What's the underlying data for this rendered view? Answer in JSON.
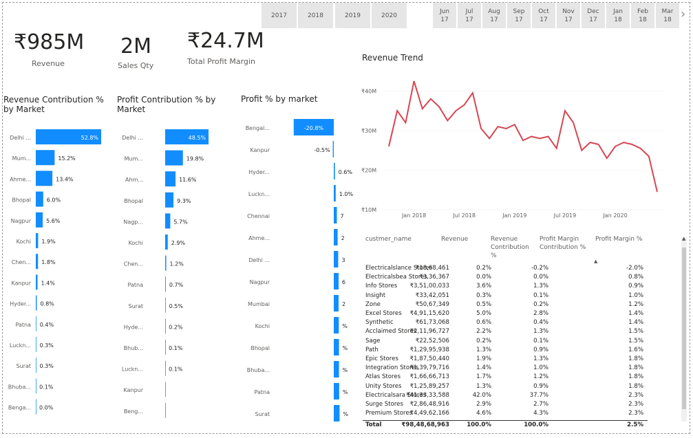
{
  "slicer_years": [
    "2017",
    "2018",
    "2019",
    "2020"
  ],
  "slicer_months": [
    [
      "Jun",
      "17"
    ],
    [
      "Jul",
      "17"
    ],
    [
      "Aug",
      "17"
    ],
    [
      "Sep",
      "17"
    ],
    [
      "Oct",
      "17"
    ],
    [
      "Nov",
      "17"
    ],
    [
      "Dec",
      "17"
    ],
    [
      "Jan",
      "18"
    ],
    [
      "Feb",
      "18"
    ],
    [
      "Mar",
      "18"
    ]
  ],
  "kpis": [
    {
      "value": "₹985M",
      "label": "Revenue"
    },
    {
      "value": "2M",
      "label": "Sales Qty"
    },
    {
      "value": "₹24.7M",
      "label": "Total Profit Margin"
    }
  ],
  "colors": {
    "bar": "#118DFF",
    "line": "#D64550",
    "grid": "#e1e1e1",
    "text": "#252423"
  },
  "chart_data": [
    {
      "type": "bar",
      "title": "Revenue Contribution % by Market",
      "categories": [
        "Delhi ...",
        "Mum...",
        "Ahme...",
        "Bhopal",
        "Nagpur",
        "Kochi",
        "Chen...",
        "Kanpur",
        "Hyder...",
        "Patna",
        "Luckn...",
        "Surat",
        "Bhuba...",
        "Benga..."
      ],
      "values": [
        52.8,
        15.2,
        13.4,
        6.0,
        5.6,
        1.9,
        1.8,
        1.4,
        0.8,
        0.4,
        0.3,
        0.3,
        0.1,
        0.0
      ],
      "labels": [
        "52.8%",
        "15.2%",
        "13.4%",
        "6.0%",
        "5.6%",
        "1.9%",
        "1.8%",
        "1.4%",
        "0.8%",
        "0.4%",
        "0.3%",
        "0.3%",
        "0.1%",
        "0.0%"
      ]
    },
    {
      "type": "bar",
      "title": "Profit Contribution % by Market",
      "categories": [
        "Delhi ...",
        "Mum...",
        "Ahm...",
        "Bhopal",
        "Nagp...",
        "Kochi",
        "Chen...",
        "Patna",
        "Surat",
        "Hyde...",
        "Bhub...",
        "Luckn...",
        "Kanpur",
        "Beng..."
      ],
      "values": [
        48.5,
        19.8,
        11.6,
        9.3,
        5.7,
        2.9,
        1.2,
        0.7,
        0.5,
        0.2,
        0.1,
        0.1,
        0,
        0
      ],
      "labels": [
        "48.5%",
        "19.8%",
        "11.6%",
        "9.3%",
        "5.7%",
        "2.9%",
        "1.2%",
        "0.7%",
        "0.5%",
        "0.2%",
        "0.1%",
        "0.1%",
        "",
        ""
      ]
    },
    {
      "type": "bar",
      "title": "Profit % by market",
      "categories": [
        "Bengal...",
        "Kanpur",
        "Hyder...",
        "Luckn...",
        "Chennai",
        "Ahme...",
        "Delhi ...",
        "Nagpur",
        "Mumbai",
        "Kochi",
        "Bhopal",
        "Bhuba...",
        "Patna",
        "Surat"
      ],
      "values": [
        -20.8,
        -0.5,
        0.6,
        1.0,
        1.6,
        2.0,
        2.3,
        2.5,
        2.5,
        2.6,
        2.7,
        2.7,
        2.8,
        3.0
      ],
      "labels": [
        "-20.8%",
        "-0.5%",
        "0.6%",
        "1.0%",
        "7",
        "2",
        "3",
        "6",
        "2",
        "%",
        "%",
        "%",
        "%",
        "%"
      ]
    },
    {
      "type": "line",
      "title": "Revenue Trend",
      "x_ticks": [
        "Jan 2018",
        "Jul 2018",
        "Jan 2019",
        "Jul 2019",
        "Jan 2020"
      ],
      "y_ticks": [
        "₹10M",
        "₹20M",
        "₹30M",
        "₹40M"
      ],
      "ylim": [
        10,
        43
      ],
      "series": [
        {
          "values": [
            26,
            35,
            32,
            42.5,
            35.5,
            38,
            36,
            32.5,
            35,
            36.5,
            39.5,
            30.5,
            28,
            31,
            30.5,
            31.5,
            27.5,
            28.5,
            28,
            28.5,
            25.5,
            35,
            32,
            25,
            27,
            26.5,
            23,
            26,
            27,
            26.5,
            25.5,
            23.5,
            14.5
          ]
        }
      ]
    }
  ],
  "table": {
    "headers": [
      "custmer_name",
      "Revenue",
      "Revenue Contribution %",
      "Profit Margin Contribution %",
      "Profit Margin %"
    ],
    "rows": [
      [
        "Electricalslance Stores",
        "₹18,68,461",
        "0.2%",
        "-0.2%",
        "-2.0%"
      ],
      [
        "Electricalsbea Stores",
        "₹3,36,367",
        "0.0%",
        "0.0%",
        "0.8%"
      ],
      [
        "Info Stores",
        "₹3,51,00,033",
        "3.6%",
        "1.3%",
        "0.9%"
      ],
      [
        "Insight",
        "₹33,42,051",
        "0.3%",
        "0.1%",
        "1.0%"
      ],
      [
        "Zone",
        "₹50,67,349",
        "0.5%",
        "0.2%",
        "1.2%"
      ],
      [
        "Excel Stores",
        "₹4,91,15,620",
        "5.0%",
        "2.8%",
        "1.4%"
      ],
      [
        "Synthetic",
        "₹61,73,068",
        "0.6%",
        "0.4%",
        "1.4%"
      ],
      [
        "Acclaimed Stores",
        "₹2,11,96,727",
        "2.2%",
        "1.3%",
        "1.5%"
      ],
      [
        "Sage",
        "₹22,52,506",
        "0.2%",
        "0.1%",
        "1.5%"
      ],
      [
        "Path",
        "₹1,29,95,938",
        "1.3%",
        "0.9%",
        "1.6%"
      ],
      [
        "Epic Stores",
        "₹1,87,50,440",
        "1.9%",
        "1.3%",
        "1.8%"
      ],
      [
        "Integration Stores",
        "₹1,39,79,716",
        "1.4%",
        "1.0%",
        "1.8%"
      ],
      [
        "Atlas Stores",
        "₹1,66,66,713",
        "1.7%",
        "1.2%",
        "1.8%"
      ],
      [
        "Unity Stores",
        "₹1,25,89,257",
        "1.3%",
        "0.9%",
        "1.8%"
      ],
      [
        "Electricalsara Stores",
        "₹41,33,33,588",
        "42.0%",
        "37.7%",
        "2.3%"
      ],
      [
        "Surge Stores",
        "₹2,86,48,916",
        "2.9%",
        "2.7%",
        "2.3%"
      ],
      [
        "Premium Stores",
        "₹4,49,62,166",
        "4.6%",
        "4.3%",
        "2.3%"
      ]
    ],
    "total": [
      "Total",
      "₹98,48,68,963",
      "100.0%",
      "100.0%",
      "2.5%"
    ],
    "sort_indicator": "▲",
    "scroll_up": "▲",
    "next_arrow": "›"
  }
}
